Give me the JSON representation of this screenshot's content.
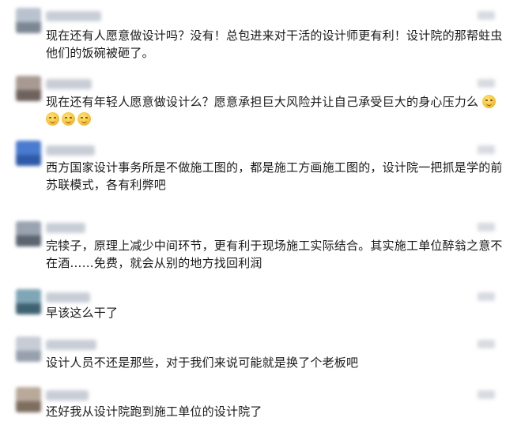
{
  "comments": [
    {
      "lines": [
        "现在还有人愿意做设计吗？没有！总包进来对干活的设计师更有利！设计院的那帮蛀虫",
        "他们的饭碗被砸了。"
      ],
      "emoji_count": 0,
      "avatar_colors": [
        "#b9c2cf",
        "#7d8794"
      ]
    },
    {
      "lines": [
        "现在还有年轻人愿意做设计么？愿意承担巨大风险并让自己承受巨大的身心压力么"
      ],
      "emoji_count": 1,
      "emoji_line2_count": 3,
      "avatar_colors": [
        "#a89a92",
        "#6f625c"
      ]
    },
    {
      "lines": [
        "西方国家设计事务所是不做施工图的，都是施工方画施工图的，设计院一把抓是学的前",
        "苏联模式，各有利弊吧"
      ],
      "emoji_count": 0,
      "avatar_colors": [
        "#4a7bd0",
        "#2f5aa8"
      ]
    },
    {
      "lines": [
        "完犊子，原理上减少中间环节，更有利于现场施工实际结合。其实施工单位醉翁之意不",
        "在酒……免费，就会从别的地方找回利润"
      ],
      "emoji_count": 0,
      "avatar_colors": [
        "#9aa3b0",
        "#5c6470"
      ]
    },
    {
      "lines": [
        "早该这么干了"
      ],
      "emoji_count": 0,
      "avatar_colors": [
        "#7fa6b5",
        "#3f6272"
      ]
    },
    {
      "lines": [
        "设计人员不还是那些，对于我们来说可能就是换了个老板吧"
      ],
      "emoji_count": 0,
      "avatar_colors": [
        "#c7ccd6",
        "#98a0ad"
      ]
    },
    {
      "lines": [
        "还好我从设计院跑到施工单位的设计院了"
      ],
      "emoji_count": 0,
      "avatar_colors": [
        "#b8a99a",
        "#7d6e60"
      ]
    }
  ],
  "colors": {
    "text": "#1a1a1a",
    "emoji": "#f7c53d",
    "background": "#ffffff"
  },
  "icons": {
    "emoji": "smile-emoji-icon",
    "like": "thumbs-up-icon"
  }
}
